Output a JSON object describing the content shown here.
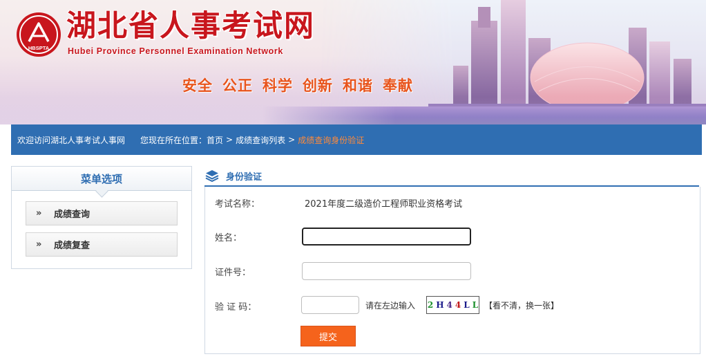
{
  "header": {
    "title": "湖北省人事考试网",
    "subtitle": "Hubei Province Personnel Examination Network",
    "logo_text": "HBSPTA",
    "slogans": [
      "安全",
      "公正",
      "科学",
      "创新",
      "和谐",
      "奉献"
    ]
  },
  "navbar": {
    "welcome": "欢迎访问湖北人事考试人事网",
    "location_label": "您现在所在位置：",
    "home": "首页",
    "crumb_list": "成绩查询列表",
    "crumb_current": "成绩查询身份验证",
    "separator": ">"
  },
  "sidebar": {
    "title": "菜单选项",
    "items": [
      {
        "arrows": "»",
        "label": "成绩查询"
      },
      {
        "arrows": "»",
        "label": "成绩复查"
      }
    ]
  },
  "panel": {
    "title": "身份验证"
  },
  "form": {
    "exam_label": "考试名称：",
    "exam_value": "2021年度二级造价工程师职业资格考试",
    "name_label": "姓名：",
    "name_value": "",
    "id_label": "证件号：",
    "id_value": "",
    "captcha_label": "验 证 码：",
    "captcha_value": "",
    "captcha_hint": "请在左边输入",
    "captcha_chars": [
      "2",
      "H",
      "4",
      "4",
      "L",
      "L"
    ],
    "captcha_colors": [
      "#1a8f2a",
      "#1b1b8a",
      "#4d2b8a",
      "#c21a1a",
      "#1b1b8a",
      "#1a8f2a"
    ],
    "refresh_label": "【看不清，换一张】",
    "submit_label": "提交"
  },
  "colors": {
    "brand_red": "#c8161d",
    "nav_blue": "#2f6eb2",
    "crumb_orange": "#ff8a3a",
    "submit_orange": "#f5631c"
  }
}
